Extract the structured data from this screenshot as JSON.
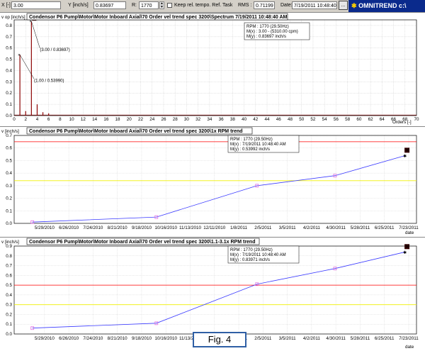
{
  "toolbar": {
    "x_label": "X [-]",
    "x_value": "3.00",
    "y_label": "Y [inch/s]",
    "y_value": "0.83697",
    "r_label": "R:",
    "r_value": "1770",
    "keep_label": "Keep rel. tempo. Ref. Task",
    "rms_label": "RMS :",
    "rms_value": "0.71199",
    "date_label": "Date:",
    "date_value": "7/19/2011 10:48:40 A",
    "more_button": "...",
    "brand": "OMNITREND c:\\"
  },
  "spectrum": {
    "title": "Condensor P6 Pump\\Motor\\Motor Inboard Axial\\70 Order vel trend spec 3200\\Spectrum 7/19/2011 10:48:40 AM",
    "ylabel": "v op [inch/s]",
    "xlabel": "Orders [-]",
    "info": [
      "RPM : 1770 (29.50Hz)",
      "M(x) : 3.00 - (5310.00 cpm)",
      "M(y) : 0.83697 inch/s"
    ],
    "annotations": [
      "(3.00 / 0.83697)",
      "(1.00 / 0.53990)"
    ],
    "marker_tag": "M",
    "x_ticks": [
      0,
      2,
      4,
      6,
      8,
      10,
      12,
      14,
      16,
      18,
      20,
      22,
      24,
      26,
      28,
      30,
      32,
      34,
      36,
      38,
      40,
      42,
      44,
      46,
      48,
      50,
      52,
      54,
      56,
      58,
      60,
      62,
      64,
      66,
      68,
      70
    ],
    "y_ticks": [
      "0.0",
      "0.1",
      "0.2",
      "0.3",
      "0.4",
      "0.5",
      "0.6",
      "0.7",
      "0.8"
    ]
  },
  "trend1": {
    "title": "Condensor P6 Pump\\Motor\\Motor Inboard Axial\\70 Order vel trend spec 3200\\1x RPM trend",
    "ylabel": "v [inch/s]",
    "xlabel": "date",
    "info": [
      "RPM : 1770 (29.50Hz)",
      "M(x) : 7/19/2011 10:48:40 AM",
      "M(y) : 0.53992 inch/s"
    ],
    "marker_tag": "M",
    "x_ticks": [
      "5/29/2010",
      "6/26/2010",
      "7/24/2010",
      "8/21/2010",
      "9/18/2010",
      "10/16/2010",
      "11/13/2010",
      "12/11/2010",
      "1/8/2011",
      "2/5/2011",
      "3/5/2011",
      "4/2/2011",
      "4/30/2011",
      "5/28/2011",
      "6/25/2011",
      "7/23/2011"
    ],
    "y_ticks": [
      "0.0",
      "0.1",
      "0.2",
      "0.3",
      "0.4",
      "0.5",
      "0.6",
      "0.7"
    ]
  },
  "trend2": {
    "title": "Condensor P6 Pump\\Motor\\Motor Inboard Axial\\70 Order vel trend spec 3200\\1.1-3.1x RPM trend",
    "ylabel": "v [inch/s]",
    "xlabel": "date",
    "info": [
      "RPM : 1770 (29.50Hz)",
      "M(x) : 7/19/2011 10:48:40 AM",
      "M(y) : 0.83971 inch/s"
    ],
    "marker_tag": "M",
    "x_ticks": [
      "5/29/2010",
      "6/26/2010",
      "7/24/2010",
      "8/21/2010",
      "9/18/2010",
      "10/16/2010",
      "11/13/2010",
      "12/11/2010",
      "1/8/2011",
      "2/5/2011",
      "3/5/2011",
      "4/2/2011",
      "4/30/2011",
      "5/28/2011",
      "6/25/2011",
      "7/23/2011"
    ],
    "y_ticks": [
      "0.0",
      "0.1",
      "0.2",
      "0.3",
      "0.4",
      "0.5",
      "0.6",
      "0.7",
      "0.8",
      "0.9"
    ]
  },
  "figure_label": "Fig. 4",
  "colors": {
    "spectrum_line": "#8b0000",
    "trend_line": "#3a3aff",
    "point": "#e070e0",
    "alarm": "#ff0000",
    "warning": "#f0f000",
    "marker": "#ff3333"
  },
  "chart_data": [
    {
      "type": "line",
      "title": "Condensor P6 Pump\\Motor\\Motor Inboard Axial\\70 Order vel trend spec 3200\\Spectrum 7/19/2011 10:48:40 AM",
      "xlabel": "Orders [-]",
      "ylabel": "v op [inch/s]",
      "xlim": [
        0,
        70
      ],
      "ylim": [
        0,
        0.85
      ],
      "grid": true,
      "peaks": {
        "x": [
          1.0,
          2.0,
          3.0,
          4.0,
          5.0,
          6.0
        ],
        "y": [
          0.5399,
          0.04,
          0.83697,
          0.1,
          0.03,
          0.02
        ]
      }
    },
    {
      "type": "line",
      "title": "Condensor P6 Pump\\Motor\\Motor Inboard Axial\\70 Order vel trend spec 3200\\1x RPM trend",
      "xlabel": "date",
      "ylabel": "v [inch/s]",
      "ylim": [
        0,
        0.7
      ],
      "grid": true,
      "alarm": 0.65,
      "warning": 0.34,
      "series": [
        {
          "x": [
            "5/15/2010",
            "10/5/2010",
            "1/29/2011",
            "4/29/2011",
            "7/19/2011"
          ],
          "y": [
            0.01,
            0.05,
            0.3,
            0.38,
            0.53992
          ]
        }
      ]
    },
    {
      "type": "line",
      "title": "Condensor P6 Pump\\Motor\\Motor Inboard Axial\\70 Order vel trend spec 3200\\1.1-3.1x RPM trend",
      "xlabel": "date",
      "ylabel": "v [inch/s]",
      "ylim": [
        0,
        0.9
      ],
      "grid": true,
      "alarm": 0.5,
      "warning": 0.3,
      "series": [
        {
          "x": [
            "5/15/2010",
            "10/5/2010",
            "1/29/2011",
            "4/29/2011",
            "7/19/2011"
          ],
          "y": [
            0.06,
            0.11,
            0.51,
            0.67,
            0.83971
          ]
        }
      ]
    }
  ]
}
